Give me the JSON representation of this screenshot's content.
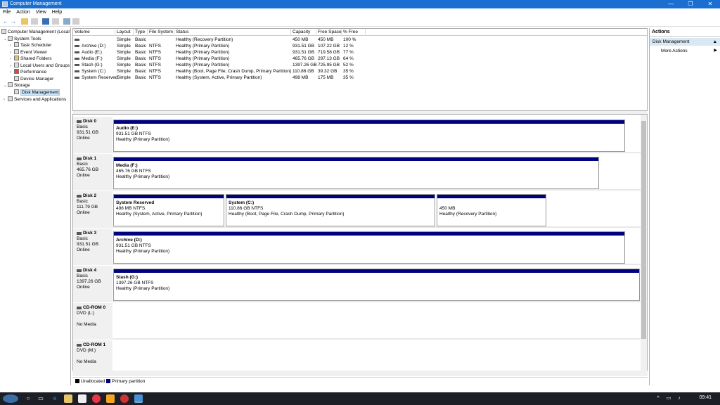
{
  "window": {
    "title": "Computer Management",
    "minimize": "—",
    "maximize": "❐",
    "close": "✕"
  },
  "menu": [
    "File",
    "Action",
    "View",
    "Help"
  ],
  "tree": {
    "root": "Computer Management (Local",
    "system_tools": "System Tools",
    "task_scheduler": "Task Scheduler",
    "event_viewer": "Event Viewer",
    "shared_folders": "Shared Folders",
    "local_users": "Local Users and Groups",
    "performance": "Performance",
    "device_manager": "Device Manager",
    "storage": "Storage",
    "disk_management": "Disk Management",
    "services": "Services and Applications"
  },
  "volume_table": {
    "headers": [
      "Volume",
      "Layout",
      "Type",
      "File System",
      "Status",
      "Capacity",
      "Free Space",
      "% Free"
    ],
    "rows": [
      [
        "",
        "Simple",
        "Basic",
        "",
        "Healthy (Recovery Partition)",
        "450 MB",
        "450 MB",
        "100 %"
      ],
      [
        "Archive (D:)",
        "Simple",
        "Basic",
        "NTFS",
        "Healthy (Primary Partition)",
        "931.51 GB",
        "107.22 GB",
        "12 %"
      ],
      [
        "Audio (E:)",
        "Simple",
        "Basic",
        "NTFS",
        "Healthy (Primary Partition)",
        "931.51 GB",
        "719.58 GB",
        "77 %"
      ],
      [
        "Media (F:)",
        "Simple",
        "Basic",
        "NTFS",
        "Healthy (Primary Partition)",
        "465.76 GB",
        "297.13 GB",
        "64 %"
      ],
      [
        "Stash (G:)",
        "Simple",
        "Basic",
        "NTFS",
        "Healthy (Primary Partition)",
        "1397.26 GB",
        "725.95 GB",
        "52 %"
      ],
      [
        "System (C:)",
        "Simple",
        "Basic",
        "NTFS",
        "Healthy (Boot, Page File, Crash Dump, Primary Partition)",
        "110.86 GB",
        "39.32 GB",
        "35 %"
      ],
      [
        "System Reserved",
        "Simple",
        "Basic",
        "NTFS",
        "Healthy (System, Active, Primary Partition)",
        "498 MB",
        "175 MB",
        "35 %"
      ]
    ]
  },
  "disks": {
    "d0": {
      "name": "Disk 0",
      "type": "Basic",
      "size": "931.51 GB",
      "state": "Online",
      "p0": {
        "name": "Audio  (E:)",
        "size": "931.51 GB NTFS",
        "status": "Healthy (Primary Partition)"
      }
    },
    "d1": {
      "name": "Disk 1",
      "type": "Basic",
      "size": "465.76 GB",
      "state": "Online",
      "p0": {
        "name": "Media  (F:)",
        "size": "465.76 GB NTFS",
        "status": "Healthy (Primary Partition)"
      }
    },
    "d2": {
      "name": "Disk 2",
      "type": "Basic",
      "size": "111.79 GB",
      "state": "Online",
      "p0": {
        "name": "System Reserved",
        "size": "498 MB NTFS",
        "status": "Healthy (System, Active, Primary Partition)"
      },
      "p1": {
        "name": "System  (C:)",
        "size": "110.86 GB NTFS",
        "status": "Healthy (Boot, Page File, Crash Dump, Primary Partition)"
      },
      "p2": {
        "name": "",
        "size": "450 MB",
        "status": "Healthy (Recovery Partition)"
      }
    },
    "d3": {
      "name": "Disk 3",
      "type": "Basic",
      "size": "931.51 GB",
      "state": "Online",
      "p0": {
        "name": "Archive  (D:)",
        "size": "931.51 GB NTFS",
        "status": "Healthy (Primary Partition)"
      }
    },
    "d4": {
      "name": "Disk 4",
      "type": "Basic",
      "size": "1397.26 GB",
      "state": "Online",
      "p0": {
        "name": "Stash  (G:)",
        "size": "1397.26 GB NTFS",
        "status": "Healthy (Primary Partition)"
      }
    },
    "cd0": {
      "name": "CD-ROM 0",
      "type": "DVD (L:)",
      "state": "No Media"
    },
    "cd1": {
      "name": "CD-ROM 1",
      "type": "DVD (M:)",
      "state": "No Media"
    }
  },
  "legend": {
    "unallocated": "Unallocated",
    "primary": "Primary partition",
    "unallocated_color": "#000000",
    "primary_color": "#000080"
  },
  "actions": {
    "header": "Actions",
    "selected": "Disk Management",
    "more": "More Actions"
  },
  "taskbar": {
    "clock": "09:41"
  }
}
